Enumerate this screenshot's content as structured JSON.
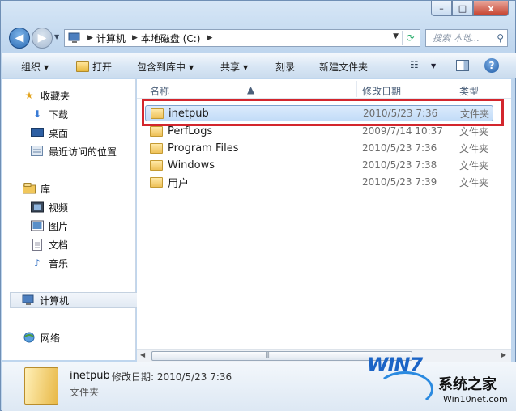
{
  "window": {
    "caption_buttons": {
      "minimize": "–",
      "maximize": "□",
      "close": "x"
    }
  },
  "address": {
    "crumbs": [
      "计算机",
      "本地磁盘 (C:)"
    ],
    "search_placeholder": "搜索 本地..."
  },
  "toolbar": {
    "organize": "组织",
    "open": "打开",
    "include_in_library": "包含到库中",
    "share": "共享",
    "burn": "刻录",
    "new_folder": "新建文件夹"
  },
  "nav": {
    "favorites": {
      "label": "收藏夹",
      "items": [
        "下载",
        "桌面",
        "最近访问的位置"
      ]
    },
    "libraries": {
      "label": "库",
      "items": [
        "视频",
        "图片",
        "文档",
        "音乐"
      ]
    },
    "computer": "计算机",
    "network": "网络"
  },
  "columns": {
    "name": "名称",
    "date": "修改日期",
    "type": "类型"
  },
  "files": [
    {
      "name": "inetpub",
      "date": "2010/5/23 7:36",
      "type": "文件夹",
      "selected": true
    },
    {
      "name": "PerfLogs",
      "date": "2009/7/14 10:37",
      "type": "文件夹"
    },
    {
      "name": "Program Files",
      "date": "2010/5/23 7:36",
      "type": "文件夹"
    },
    {
      "name": "Windows",
      "date": "2010/5/23 7:38",
      "type": "文件夹"
    },
    {
      "name": "用户",
      "date": "2010/5/23 7:39",
      "type": "文件夹"
    }
  ],
  "details": {
    "name": "inetpub",
    "meta": "修改日期: 2010/5/23 7:36",
    "type": "文件夹"
  },
  "watermark": {
    "logo": "WIN7",
    "site": "系统之家",
    "url": "Win10net.com"
  },
  "colors": {
    "highlight": "#d3262d",
    "selection": "#c2dcf8"
  }
}
